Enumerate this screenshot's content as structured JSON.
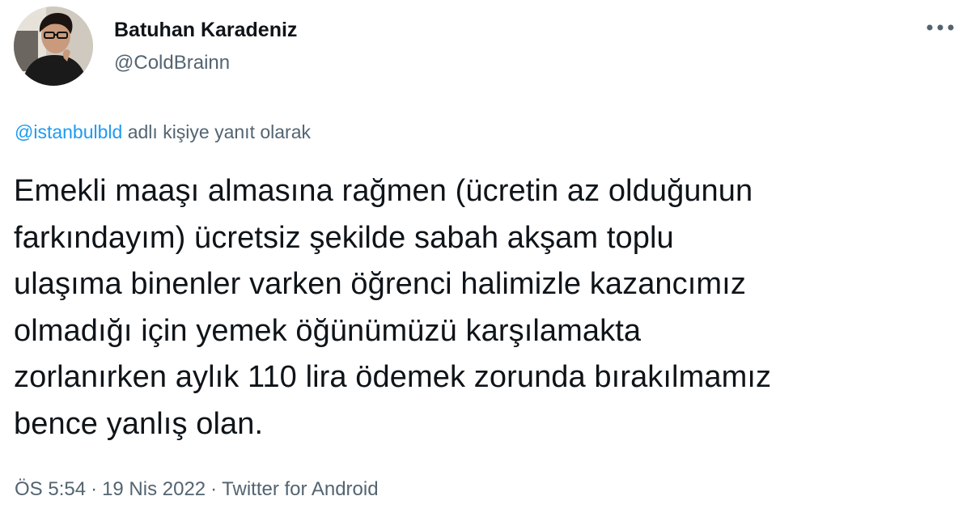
{
  "author": {
    "display_name": "Batuhan Karadeniz",
    "handle": "@ColdBrainn",
    "avatar_icon": "profile-photo"
  },
  "menu": {
    "icon": "more-horizontal-icon"
  },
  "reply_context": {
    "mention": "@istanbulbld",
    "suffix": " adlı kişiye yanıt olarak"
  },
  "tweet": {
    "lines": [
      "Emekli maaşı almasına rağmen (ücretin az olduğunun",
      "farkındayım) ücretsiz şekilde sabah akşam toplu",
      "ulaşıma binenler varken öğrenci halimizle kazancımız",
      "olmadığı için yemek öğünümüzü karşılamakta",
      "zorlanırken aylık 110 lira ödemek zorunda bırakılmamız",
      "bence yanlış olan."
    ]
  },
  "meta": {
    "time": "ÖS 5:54",
    "separator": "·",
    "date": "19 Nis 2022",
    "source": "Twitter for Android"
  },
  "colors": {
    "text": "#0f1419",
    "secondary": "#536471",
    "link": "#1d9bf0"
  }
}
